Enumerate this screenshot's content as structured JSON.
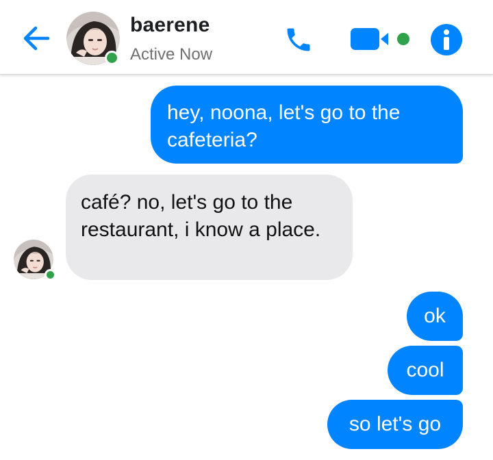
{
  "header": {
    "contact_name": "baerene",
    "status": "Active Now",
    "status_color": "#31a24c",
    "accent": "#0084ff",
    "icons": [
      "back-arrow-icon",
      "phone-icon",
      "video-camera-icon",
      "info-icon"
    ]
  },
  "messages": [
    {
      "sender": "me",
      "text": "hey, noona, let's go to the cafeteria?"
    },
    {
      "sender": "baerene",
      "text": "café? no, let's go to the restaurant, i know a place."
    },
    {
      "sender": "me",
      "text": "ok"
    },
    {
      "sender": "me",
      "text": "cool"
    },
    {
      "sender": "me",
      "text": "so let's go"
    }
  ],
  "colors": {
    "outgoing_bubble": "#0084ff",
    "incoming_bubble": "#e9e9eb"
  }
}
